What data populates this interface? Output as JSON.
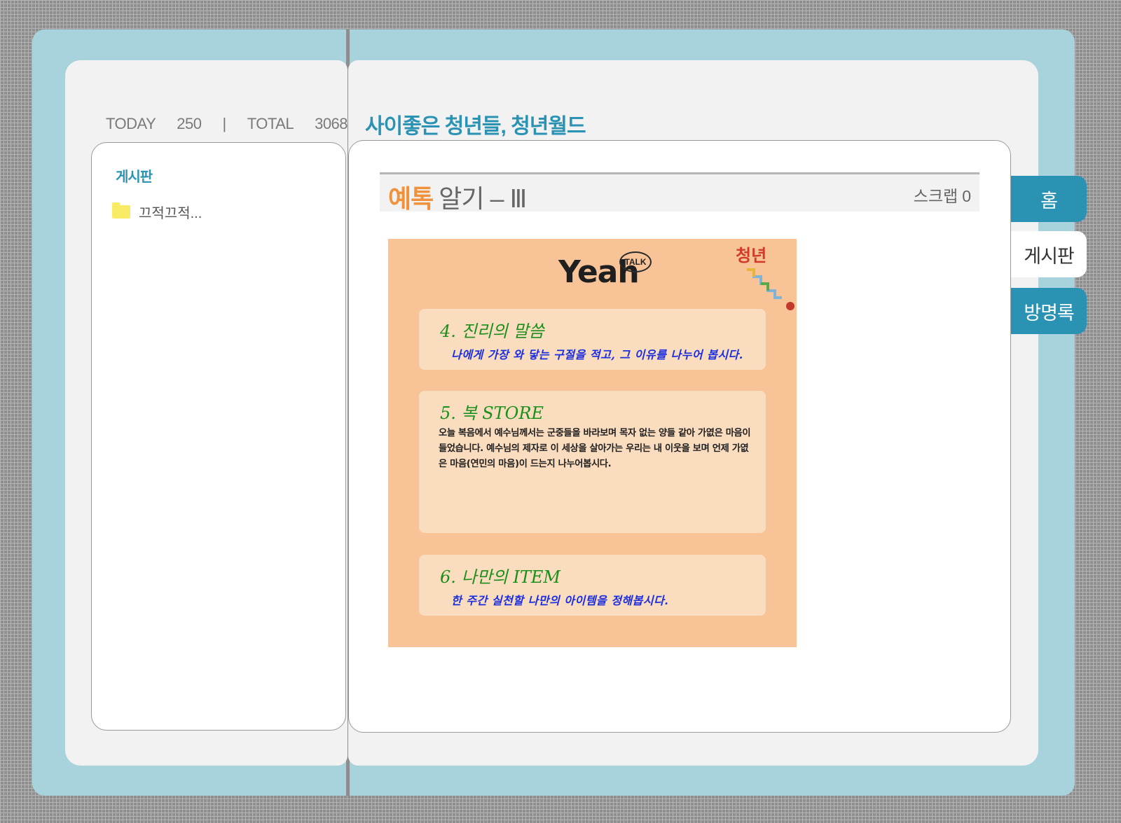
{
  "visitor": {
    "today_label": "TODAY",
    "today_count": "250",
    "separator": "|",
    "total_label": "TOTAL",
    "total_count": "3068"
  },
  "site_title": "사이좋은 청년들, 청년월드",
  "sidebar": {
    "heading": "게시판",
    "folders": [
      {
        "label": "끄적끄적..."
      }
    ]
  },
  "post": {
    "title_highlight": "예톡",
    "title_rest": "알기 – Ⅲ",
    "scrap_label": "스크랩",
    "scrap_count": "0"
  },
  "poster": {
    "logo_main": "Yeah",
    "logo_badge": "TALK",
    "logo_corner_text": "청년",
    "cards": [
      {
        "title": "4. 진리의 말씀",
        "body": "나에게 가장 와 닿는 구절을 적고, 그 이유를 나누어 봅시다."
      },
      {
        "title": "5. 복 STORE",
        "body": "오늘 복음에서 예수님께서는 군중들을 바라보며 목자 없는 양들 같아 가엾은 마음이 들었습니다. 예수님의 제자로 이 세상을 살아가는 우리는 내 이웃을 보며 언제 가엾은 마음(연민의 마음)이 드는지 나누어봅시다."
      },
      {
        "title": "6. 나만의 ITEM",
        "body": "한 주간 실천할 나만의 아이템을 정해봅시다."
      }
    ]
  },
  "tabs": [
    {
      "label": "홈",
      "active": true
    },
    {
      "label": "게시판",
      "active": false
    },
    {
      "label": "방명록",
      "active": true
    }
  ],
  "colors": {
    "frame_blue": "#a9d3dc",
    "accent_teal": "#2a93b4",
    "title_orange": "#f0913c",
    "poster_peach": "#f8c397",
    "card_peach": "#fadcbf",
    "card_title_green": "#1b8f1b",
    "card_body_blue": "#1a2ee0",
    "folder_yellow": "#f8ec66"
  }
}
